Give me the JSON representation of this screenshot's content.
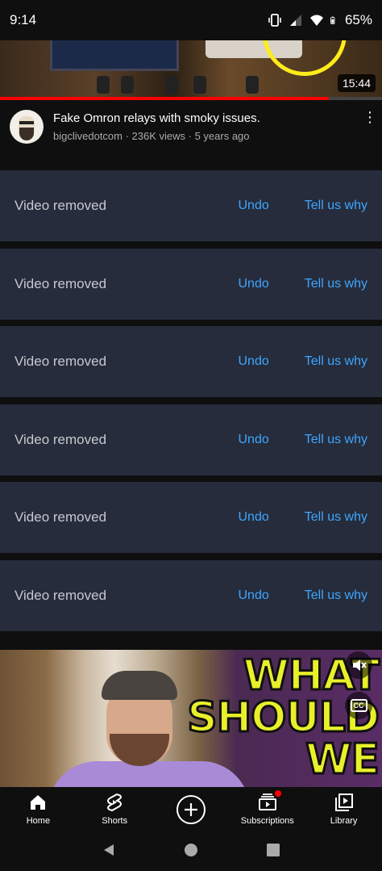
{
  "status_bar": {
    "time": "9:14",
    "battery": "65%",
    "icons": [
      "vibrate-icon",
      "signal-icon",
      "wifi-icon",
      "battery-icon"
    ]
  },
  "top_video": {
    "duration": "15:44",
    "watched_fraction": 0.86,
    "title": "Fake Omron relays with smoky issues.",
    "meta": "bigclivedotcom · 236K views · 5 years ago",
    "menu_icon": "more-vert-icon"
  },
  "removed_items": [
    {
      "message": "Video removed",
      "undo": "Undo",
      "why": "Tell us why"
    },
    {
      "message": "Video removed",
      "undo": "Undo",
      "why": "Tell us why"
    },
    {
      "message": "Video removed",
      "undo": "Undo",
      "why": "Tell us why"
    },
    {
      "message": "Video removed",
      "undo": "Undo",
      "why": "Tell us why"
    },
    {
      "message": "Video removed",
      "undo": "Undo",
      "why": "Tell us why"
    },
    {
      "message": "Video removed",
      "undo": "Undo",
      "why": "Tell us why"
    }
  ],
  "bottom_video": {
    "overlay_text_lines": [
      "WHAT",
      "SHOULD",
      "WE"
    ],
    "mute_icon": "volume-off-icon",
    "cc_label": "CC"
  },
  "bottom_nav": {
    "items": [
      {
        "label": "Home",
        "icon": "home-icon"
      },
      {
        "label": "Shorts",
        "icon": "shorts-icon"
      },
      {
        "label": "",
        "icon": "create-plus-icon"
      },
      {
        "label": "Subscriptions",
        "icon": "subscriptions-icon"
      },
      {
        "label": "Library",
        "icon": "library-icon"
      }
    ]
  },
  "colors": {
    "accent_link": "#3ea6ff",
    "removed_row_bg": "#262c3b",
    "progress_red": "#ff0000",
    "overlay_yellow": "#e9f02a"
  }
}
